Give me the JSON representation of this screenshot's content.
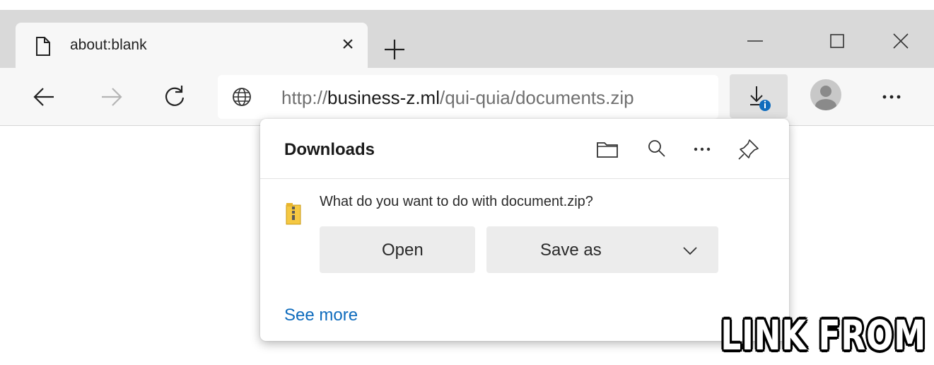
{
  "tab": {
    "title": "about:blank",
    "close_glyph": "×",
    "icon": "page-icon"
  },
  "window": {
    "new_tab_icon": "plus-icon",
    "controls": [
      "minimize-icon",
      "maximize-icon",
      "close-icon"
    ]
  },
  "toolbar": {
    "back_icon": "arrow-left-icon",
    "forward_icon": "arrow-right-icon",
    "refresh_icon": "refresh-icon",
    "address": {
      "scheme": "http://",
      "host": "business-z.ml",
      "path": "/qui-quia/documents.zip",
      "icon": "globe-icon"
    },
    "downloads_icon": "download-icon",
    "profile_icon": "avatar",
    "more_icon": "more-icon"
  },
  "downloads_flyout": {
    "title": "Downloads",
    "header_icons": [
      "folder-icon",
      "search-icon",
      "more-icon",
      "pin-icon"
    ],
    "prompt": "What do you want to do with document.zip?",
    "file_icon": "zip-file-icon",
    "open_label": "Open",
    "save_as_label": "Save as",
    "see_more_label": "See more"
  },
  "caption": "LINK FROM EMAIL",
  "colors": {
    "tabstrip": "#d9d9d9",
    "toolbar": "#f7f7f7",
    "link": "#0f6cbd",
    "button": "#ececec",
    "badge": "#0f6cbd"
  }
}
